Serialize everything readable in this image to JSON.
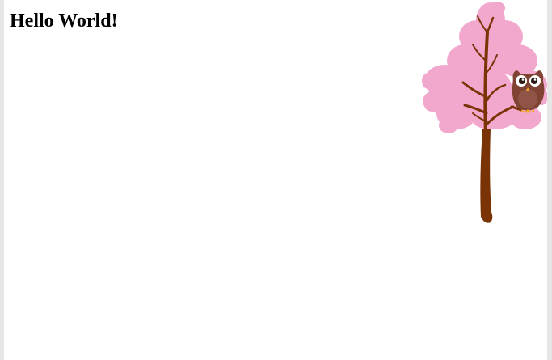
{
  "page": {
    "heading": "Hello World!"
  },
  "illustration": {
    "icons": [
      "cherry-blossom-tree-icon",
      "owl-icon"
    ],
    "colors": {
      "blossom": "#f2a7cc",
      "bark": "#7a3305",
      "owl_body": "#7e4332",
      "owl_belly": "#8f5445",
      "owl_feet": "#f5a623",
      "owl_eye_ring": "#ffffff",
      "owl_pupil": "#2b1a14"
    }
  }
}
